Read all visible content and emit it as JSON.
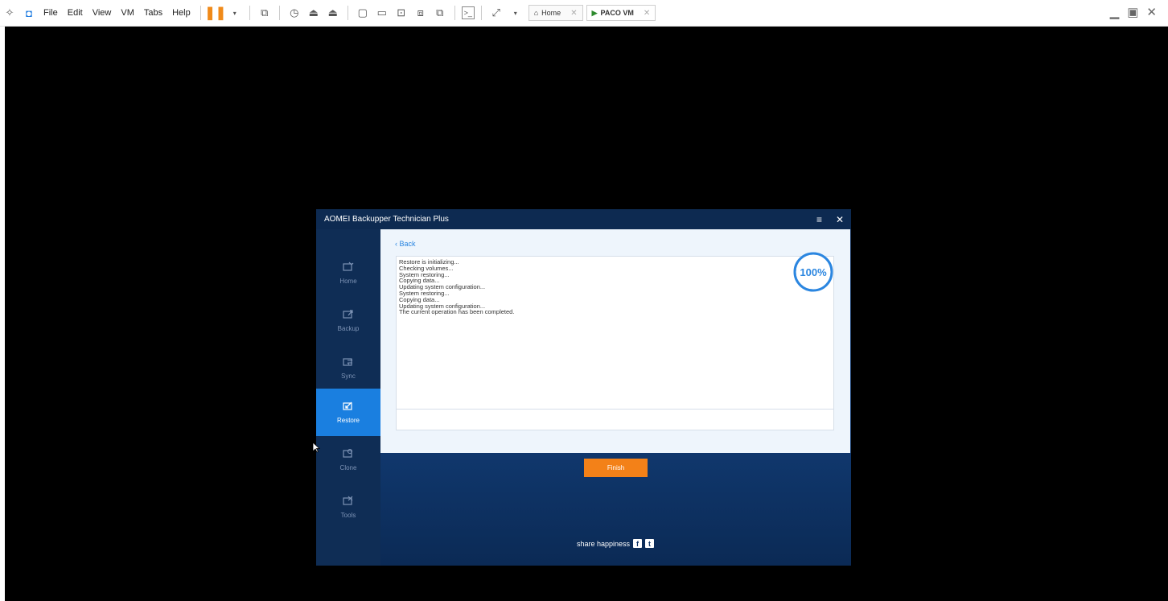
{
  "vm_menu": {
    "file": "File",
    "edit": "Edit",
    "view": "View",
    "vm": "VM",
    "tabs": "Tabs",
    "help": "Help"
  },
  "vm_tabs": [
    {
      "label": "Home",
      "icon": "home-icon"
    },
    {
      "label": "PACO VM",
      "icon": "vm-play-icon"
    }
  ],
  "app": {
    "title": "AOMEI Backupper Technician Plus",
    "back_label": "‹ Back",
    "progress_label": "100%",
    "progress_value": 1.0,
    "log_lines": [
      "Restore is initializing...",
      "Checking volumes...",
      "System restoring...",
      "Copying data...",
      "Updating system configuration...",
      "System restoring...",
      "Copying data...",
      "Updating system configuration...",
      "The current operation has been completed."
    ],
    "finish_label": "Finish",
    "share_label": "share happiness",
    "colors": {
      "accent": "#1a7fe0",
      "finish": "#f38118",
      "panel": "#eef5fc"
    }
  },
  "sidebar": {
    "items": [
      {
        "label": "Home",
        "icon": "home-monitor-icon",
        "active": false
      },
      {
        "label": "Backup",
        "icon": "backup-icon",
        "active": false
      },
      {
        "label": "Sync",
        "icon": "sync-icon",
        "active": false
      },
      {
        "label": "Restore",
        "icon": "restore-icon",
        "active": true
      },
      {
        "label": "Clone",
        "icon": "clone-icon",
        "active": false
      },
      {
        "label": "Tools",
        "icon": "tools-icon",
        "active": false
      }
    ]
  }
}
